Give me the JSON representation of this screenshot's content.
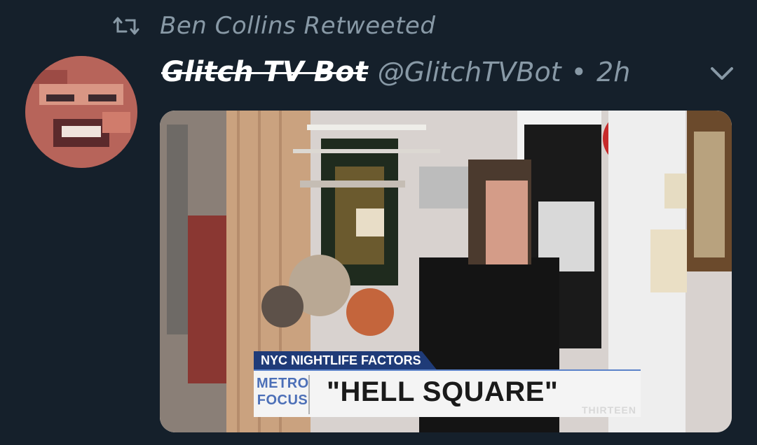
{
  "retweet": {
    "label": "Ben Collins Retweeted"
  },
  "tweet": {
    "display_name": "Glitch TV Bot",
    "handle": "@GlitchTVBot",
    "separator": "•",
    "time": "2h"
  },
  "media": {
    "lower_third": {
      "topic": "NYC NIGHTLIFE FACTORS",
      "headline": "\"HELL SQUARE\"",
      "logo_line1": "METRO",
      "logo_line2": "FOCUS",
      "brand": "THIRTEEN"
    }
  },
  "colors": {
    "background": "#15202b",
    "secondary_text": "#8899a6",
    "primary_text": "#ffffff",
    "banner_blue": "#1f3b78"
  },
  "icons": [
    "retweet-icon",
    "chevron-down-icon"
  ]
}
